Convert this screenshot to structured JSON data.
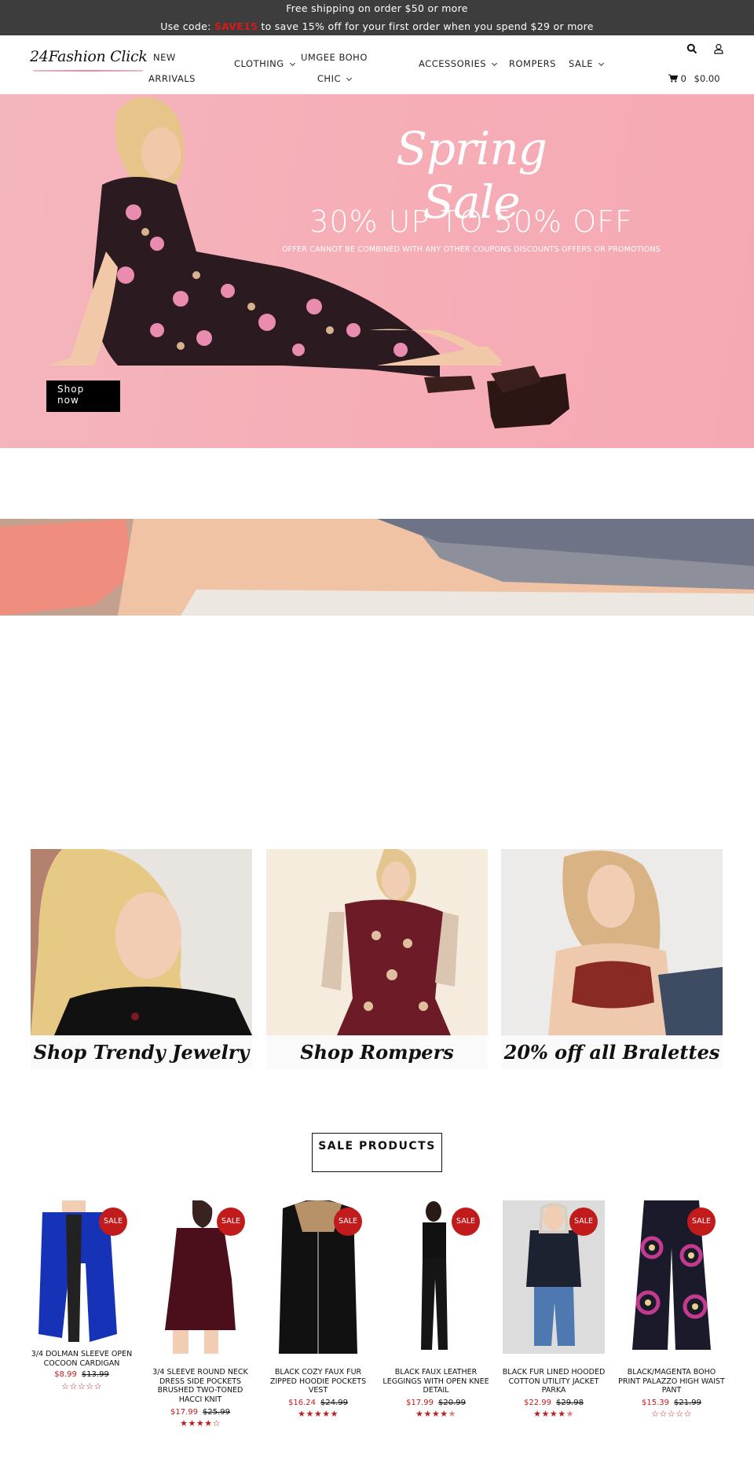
{
  "announcement": {
    "line1": "Free shipping on order $50 or more",
    "line2_prefix": "Use code: ",
    "line2_code": "SAVE15",
    "line2_suffix": " to save 15% off for your first order when you spend $29 or more"
  },
  "header": {
    "logo_text": "24Fashion Click",
    "nav": [
      {
        "label_line1": "NEW",
        "label_line2": "ARRIVALS"
      },
      {
        "label": "CLOTHING"
      },
      {
        "label_line1": "UMGEE BOHO",
        "label_line2": "CHIC"
      },
      {
        "label": "ACCESSORIES"
      },
      {
        "label": "ROMPERS"
      },
      {
        "label": "SALE"
      }
    ],
    "cart_count": "0",
    "cart_total": "$0.00"
  },
  "hero": {
    "title": "Spring Sale",
    "subtitle": "30% UP TO 50% OFF",
    "note": "OFFER CANNOT BE COMBINED WITH ANY OTHER COUPONS DISCOUNTS OFFERS OR PROMOTIONS",
    "button": "Shop now"
  },
  "tiles": [
    {
      "caption": "Shop Trendy Jewelry"
    },
    {
      "caption": "Shop Rompers"
    },
    {
      "caption": "20% off all Bralettes"
    }
  ],
  "sale_section": {
    "title": "SALE PRODUCTS"
  },
  "products": [
    {
      "name": "3/4 DOLMAN SLEEVE OPEN COCOON CARDIGAN",
      "price": "$8.99",
      "old_price": "$13.99",
      "badge": "SALE",
      "rating": 0
    },
    {
      "name": "3/4 SLEEVE ROUND NECK DRESS SIDE POCKETS BRUSHED TWO-TONED HACCI KNIT",
      "price": "$17.99",
      "old_price": "$25.99",
      "badge": "SALE",
      "rating": 4
    },
    {
      "name": "BLACK COZY FAUX FUR ZIPPED HOODIE POCKETS VEST",
      "price": "$16.24",
      "old_price": "$24.99",
      "badge": "SALE",
      "rating": 5
    },
    {
      "name": "BLACK FAUX LEATHER LEGGINGS WITH OPEN KNEE DETAIL",
      "price": "$17.99",
      "old_price": "$20.99",
      "badge": "SALE",
      "rating": 4.5
    },
    {
      "name": "BLACK FUR LINED HOODED COTTON UTILITY JACKET PARKA",
      "price": "$22.99",
      "old_price": "$29.98",
      "badge": "SALE",
      "rating": 4.5
    },
    {
      "name": "BLACK/MAGENTA BOHO PRINT PALAZZO HIGH WAIST PANT",
      "price": "$15.39",
      "old_price": "$21.99",
      "badge": "SALE",
      "rating": 0
    }
  ],
  "colors": {
    "announcement_bg": "#3d3d3d",
    "promo_code": "#d71919",
    "hero_bg": "#f5b0b8",
    "sale_red": "#c11b1b"
  }
}
